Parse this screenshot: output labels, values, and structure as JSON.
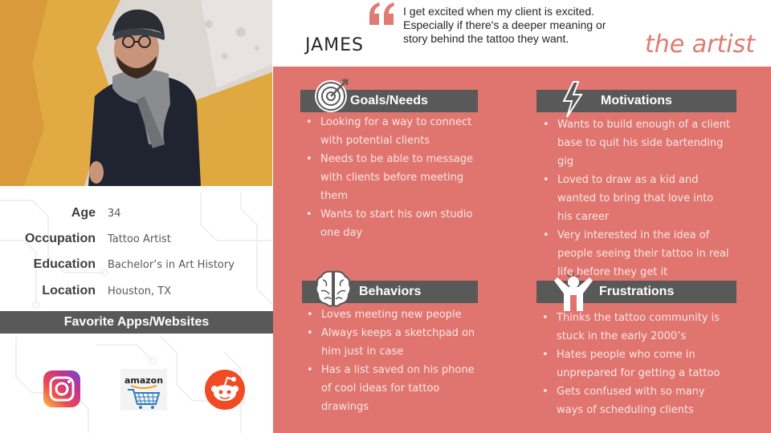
{
  "persona": {
    "name": "JAMES",
    "role": "the artist",
    "quote": "I get excited when my client is excited. Especially if there's a deeper meaning or story behind the tattoo they want."
  },
  "details": [
    {
      "label": "Age",
      "value": "34"
    },
    {
      "label": "Occupation",
      "value": "Tattoo Artist"
    },
    {
      "label": "Education",
      "value": "Bachelor’s in Art History"
    },
    {
      "label": "Location",
      "value": "Houston, TX"
    }
  ],
  "apps": {
    "title": "Favorite Apps/Websites",
    "items": [
      {
        "icon": "instagram-icon"
      },
      {
        "icon": "amazon-icon",
        "text": "amazon"
      },
      {
        "icon": "reddit-icon"
      }
    ]
  },
  "sections": {
    "goals": {
      "title": "Goals/Needs",
      "icon": "target-icon",
      "items": [
        "Looking for a way to connect with potential clients",
        "Needs to be able to message with clients before meeting them",
        "Wants to start his own studio one day"
      ]
    },
    "motivations": {
      "title": "Motivations",
      "icon": "lightning-icon",
      "items": [
        "Wants to build enough of a client base to quit his side bartending gig",
        "Loved to draw as a kid and wanted to bring that love into his career",
        "Very interested in the idea of people seeing their tattoo in real life before they get it"
      ]
    },
    "behaviors": {
      "title": "Behaviors",
      "icon": "brain-icon",
      "items": [
        "Loves meeting new people",
        "Always keeps a sketchpad on him just in case",
        "Has a list saved on his phone of cool ideas for tattoo drawings"
      ]
    },
    "frustrations": {
      "title": "Frustrations",
      "icon": "frustrated-person-icon",
      "items": [
        "Thinks the tattoo community is stuck in the early 2000’s",
        "Hates people who come in unprepared for getting a tattoo",
        "Gets confused with so many ways of scheduling clients"
      ]
    }
  },
  "colors": {
    "accent": "#e0756f",
    "dark_bar": "#595959",
    "quote_mark": "#e07a73"
  }
}
